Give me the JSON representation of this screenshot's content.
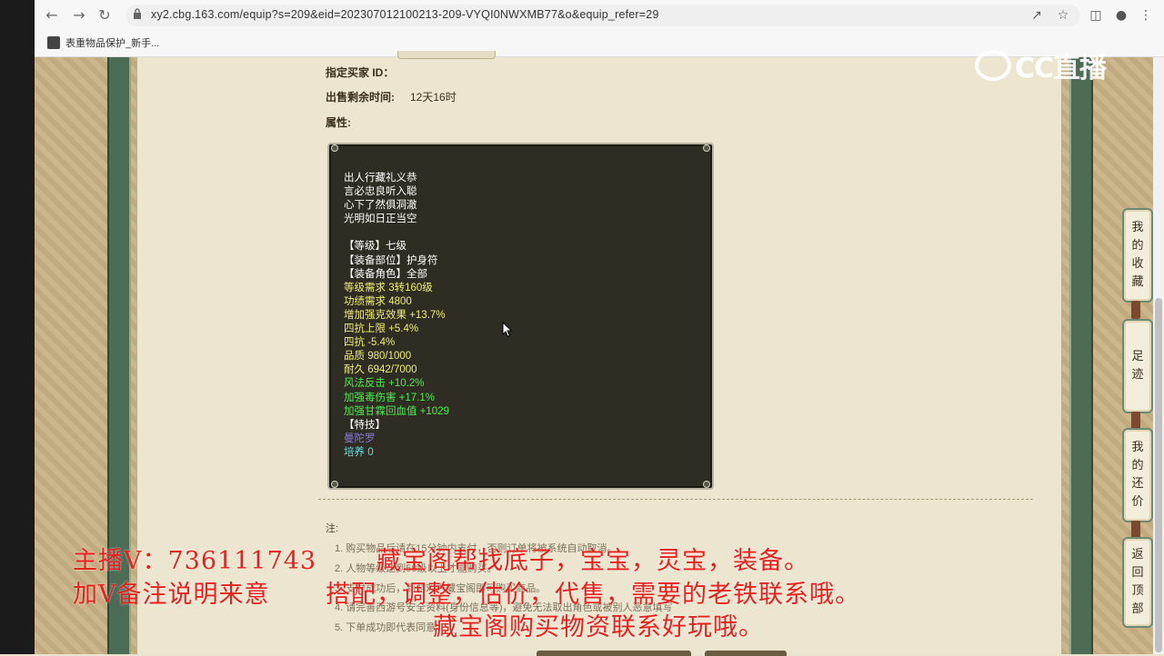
{
  "browser": {
    "url": "xy2.cbg.163.com/equip?s=209&eid=202307012100213-209-VYQI0NWXMB77&o&equip_refer=29",
    "bookmark_label": "表重物品保护_新手..."
  },
  "fields": {
    "buyer_id_label": "指定买家 ID：",
    "remaining_label": "出售剩余时间:",
    "remaining_value": "12天16时",
    "attributes_label": "属性:"
  },
  "item": {
    "lines": [
      {
        "text": "出人行藏礼义恭",
        "color": "white"
      },
      {
        "text": "言必忠良听入聪",
        "color": "white"
      },
      {
        "text": "心下了然俱洞澈",
        "color": "white"
      },
      {
        "text": "光明如日正当空",
        "color": "white"
      },
      {
        "text": "",
        "color": "white"
      },
      {
        "text": "【等级】七级",
        "color": "white"
      },
      {
        "text": "【装备部位】护身符",
        "color": "white"
      },
      {
        "text": "【装备角色】全部",
        "color": "white"
      },
      {
        "text": "等级需求 3转160级",
        "color": "yellow"
      },
      {
        "text": "功绩需求 4800",
        "color": "yellow"
      },
      {
        "text": "增加强克效果 +13.7%",
        "color": "yellow"
      },
      {
        "text": "四抗上限 +5.4%",
        "color": "yellow"
      },
      {
        "text": "四抗 -5.4%",
        "color": "yellow"
      },
      {
        "text": "品质 980/1000",
        "color": "yellow"
      },
      {
        "text": "耐久 6942/7000",
        "color": "yellow"
      },
      {
        "text": "风法反击 +10.2%",
        "color": "green"
      },
      {
        "text": "加强毒伤害 +17.1%",
        "color": "green"
      },
      {
        "text": "加强甘霖回血值 +1029",
        "color": "green"
      },
      {
        "text": "【特技】",
        "color": "white"
      },
      {
        "text": "曼陀罗",
        "color": "purple"
      },
      {
        "text": "培养 0",
        "color": "cyan"
      }
    ]
  },
  "notes": {
    "title": "注:",
    "items": [
      "1. 购买物品后请在15分钟内支付，否则订单将被系统自动取消。",
      "2. 人物等级达到50级以上才能购买。",
      "3. 支付成功后，到游戏内藏宝阁即可购买商品。",
      "4. 请完善西游号安全资料(身份信息等)，避免无法取出角色或被别人恶意填写",
      "5. 下单成功即代表同意"
    ]
  },
  "overlay": {
    "line1a": "主播V：736111743",
    "line1b": "藏宝阁帮找底子，宝宝，灵宝，装备。",
    "line2a": "加V备注说明来意",
    "line2b": "搭配，调整，估价，代售，需要的老铁联系哦。",
    "line3": "藏宝阁购买物资联系好玩哦。"
  },
  "watermark": {
    "text": "CC直播"
  },
  "side_nav": [
    {
      "label": [
        "我",
        "的",
        "收",
        "藏"
      ]
    },
    {
      "label": [
        "足",
        "迹"
      ]
    },
    {
      "label": [
        "我",
        "的",
        "还",
        "价"
      ]
    },
    {
      "label": [
        "返",
        "回",
        "顶",
        "部"
      ]
    }
  ],
  "colors": {
    "white": "#ffffff",
    "yellow": "#f0f072",
    "green": "#4cf04c",
    "purple": "#8f77d8",
    "cyan": "#5fe3e3",
    "overlay_red": "#e8201c"
  }
}
